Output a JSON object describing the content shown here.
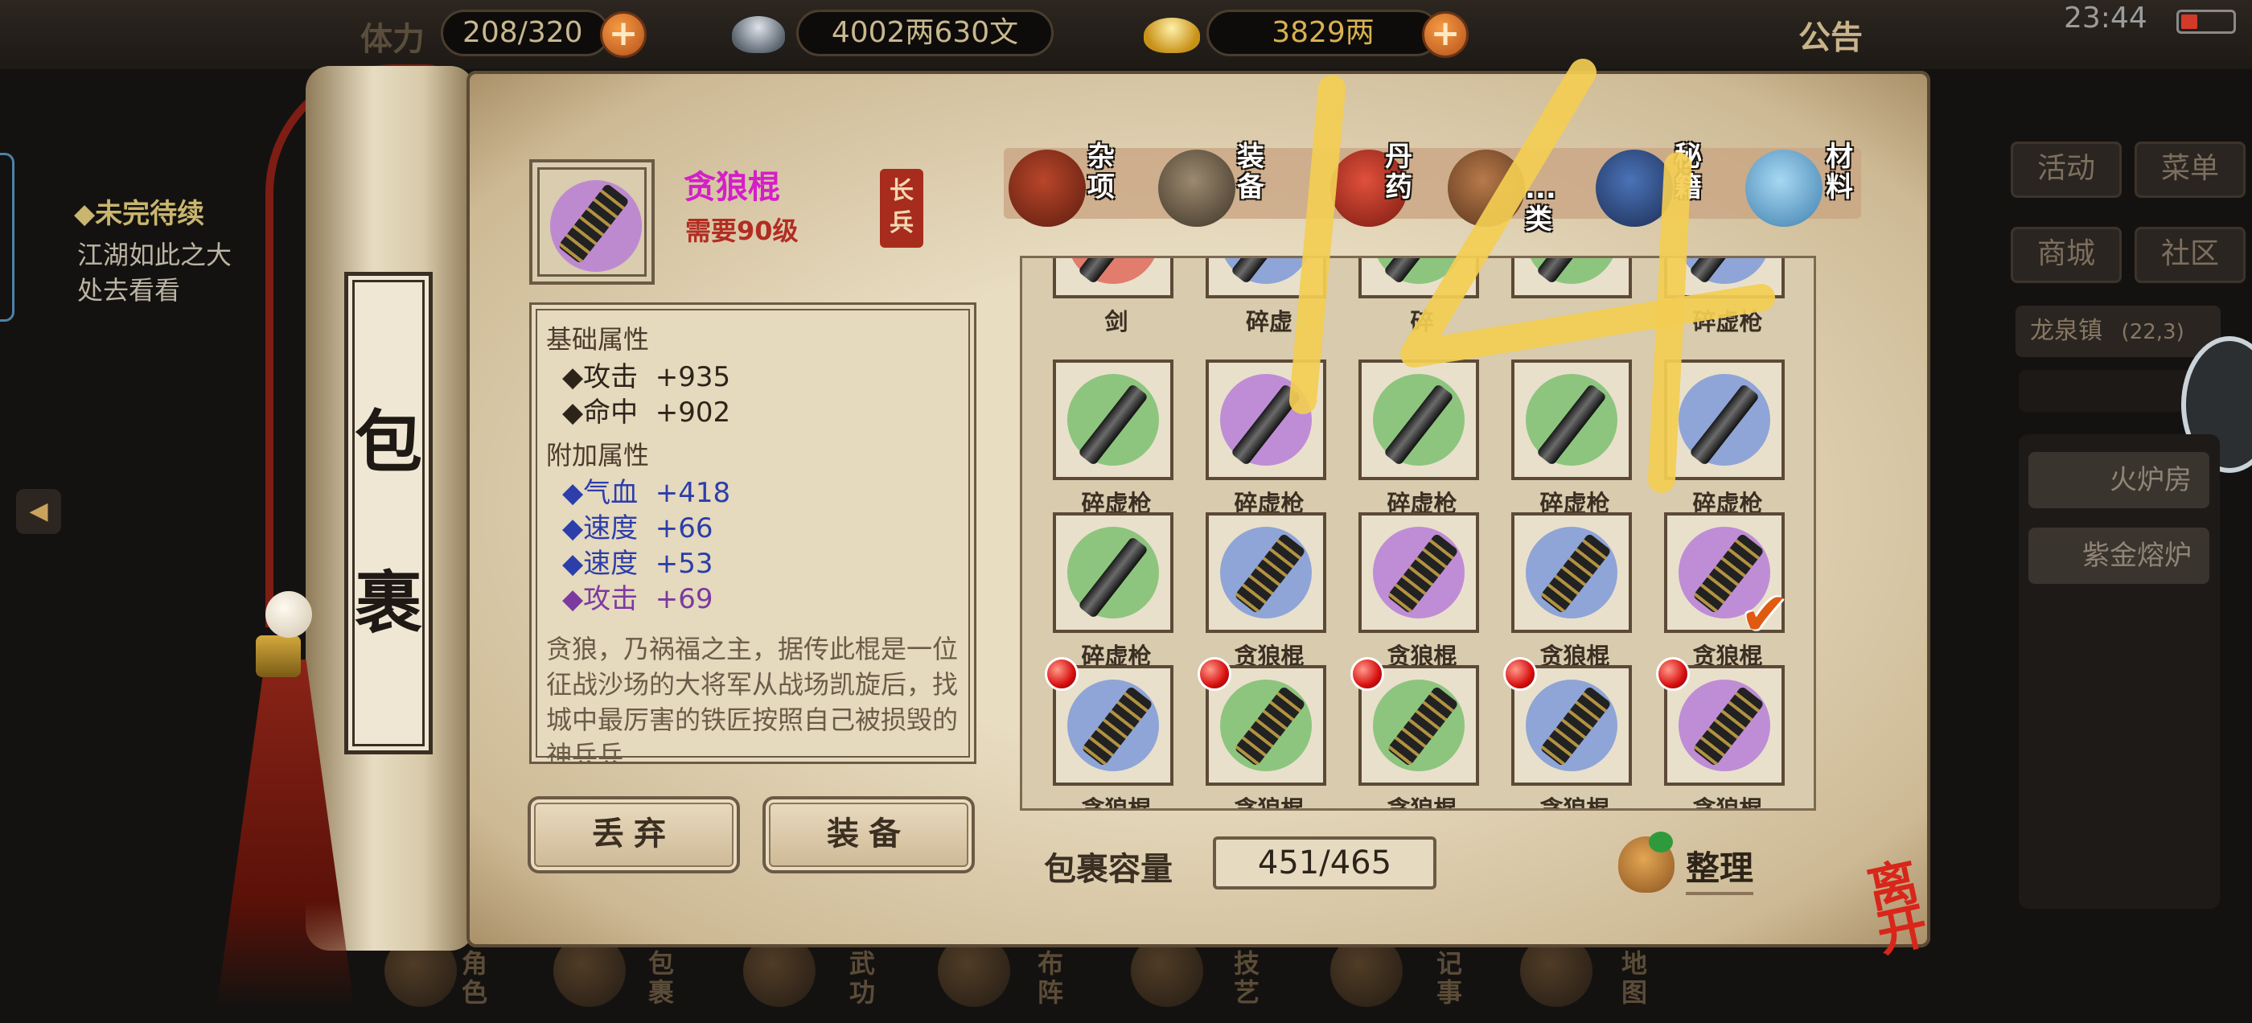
{
  "topbar": {
    "stamina_label_faded": "体力",
    "stamina_value": "208/320",
    "silver_value": "4002两630文",
    "gold_value": "3829两",
    "announcement": "公告",
    "clock": "23:44"
  },
  "quest": {
    "title": "◆未完待续",
    "lines": [
      "江湖如此之大",
      "处去看看"
    ]
  },
  "scroll_title": [
    "包",
    "裹"
  ],
  "item": {
    "name": "贪狼棍",
    "requirement": "需要90级",
    "type_stamp": [
      "长",
      "兵"
    ],
    "base_header": "基础属性",
    "base_stats": [
      "◆攻击  +935",
      "◆命中  +902"
    ],
    "extra_header": "附加属性",
    "extra_stats": [
      "◆气血  +418",
      "◆速度  +66",
      "◆速度  +53",
      "◆攻击  +69"
    ],
    "description": "贪狼，乃祸福之主，据传此棍是一位征战沙场的大将军从战场凯旋后，找城中最厉害的铁匠按照自己被损毁的神兵兵"
  },
  "actions": {
    "discard": "丢弃",
    "equip": "装备"
  },
  "categories": [
    {
      "label": "杂项",
      "icon": "jar-icon"
    },
    {
      "label": "装备",
      "icon": "equipment-icon"
    },
    {
      "label": "丹药",
      "icon": "pill-icon"
    },
    {
      "label": "...类",
      "icon": "vase-icon"
    },
    {
      "label": "秘籍",
      "icon": "book-icon"
    },
    {
      "label": "材料",
      "icon": "crystal-icon"
    }
  ],
  "inventory": {
    "rows": [
      [
        {
          "label": "剑",
          "color": "#e06a5c",
          "kind": "sword"
        },
        {
          "label": "碎虚",
          "color": "#7f9ad8",
          "kind": "spear"
        },
        {
          "label": "碎",
          "color": "#7cc070",
          "kind": "spear"
        },
        {
          "label": "",
          "color": "#7cc070",
          "kind": "spear"
        },
        {
          "label": "碎虚枪",
          "color": "#7f9ad8",
          "kind": "spear"
        }
      ],
      [
        {
          "label": "碎虚枪",
          "color": "#7cc070",
          "kind": "spear"
        },
        {
          "label": "碎虚枪",
          "color": "#b77ed6",
          "kind": "spear"
        },
        {
          "label": "碎虚枪",
          "color": "#7cc070",
          "kind": "spear"
        },
        {
          "label": "碎虚枪",
          "color": "#7cc070",
          "kind": "spear"
        },
        {
          "label": "碎虚枪",
          "color": "#7f9ad8",
          "kind": "spear"
        }
      ],
      [
        {
          "label": "碎虚枪",
          "color": "#7cc070",
          "kind": "spear"
        },
        {
          "label": "贪狼棍",
          "color": "#7f9ad8",
          "kind": "stick"
        },
        {
          "label": "贪狼棍",
          "color": "#b77ed6",
          "kind": "stick"
        },
        {
          "label": "贪狼棍",
          "color": "#7f9ad8",
          "kind": "stick"
        },
        {
          "label": "贪狼棍",
          "color": "#b77ed6",
          "kind": "stick",
          "selected": true
        }
      ],
      [
        {
          "label": "贪狼棍",
          "color": "#7f9ad8",
          "kind": "stick",
          "new": true
        },
        {
          "label": "贪狼棍",
          "color": "#7cc070",
          "kind": "stick",
          "new": true
        },
        {
          "label": "贪狼棍",
          "color": "#7cc070",
          "kind": "stick",
          "new": true
        },
        {
          "label": "贪狼棍",
          "color": "#7f9ad8",
          "kind": "stick",
          "new": true
        },
        {
          "label": "贪狼棍",
          "color": "#b77ed6",
          "kind": "stick",
          "new": true
        }
      ]
    ]
  },
  "capacity": {
    "label": "包裹容量",
    "value": "451/465"
  },
  "sort_label": "整理",
  "leave_label": "离开",
  "right_panel": {
    "buttons": [
      "活动",
      "菜单",
      "商城",
      "社区"
    ],
    "location": "龙泉镇",
    "coords": "(22,3)",
    "sub_items": [
      "火炉房",
      "紫金熔炉"
    ]
  },
  "bottom_nav": [
    "角色",
    "包裹",
    "武功",
    "布阵",
    "技艺",
    "记事",
    "地图"
  ],
  "overlay_text": "14"
}
